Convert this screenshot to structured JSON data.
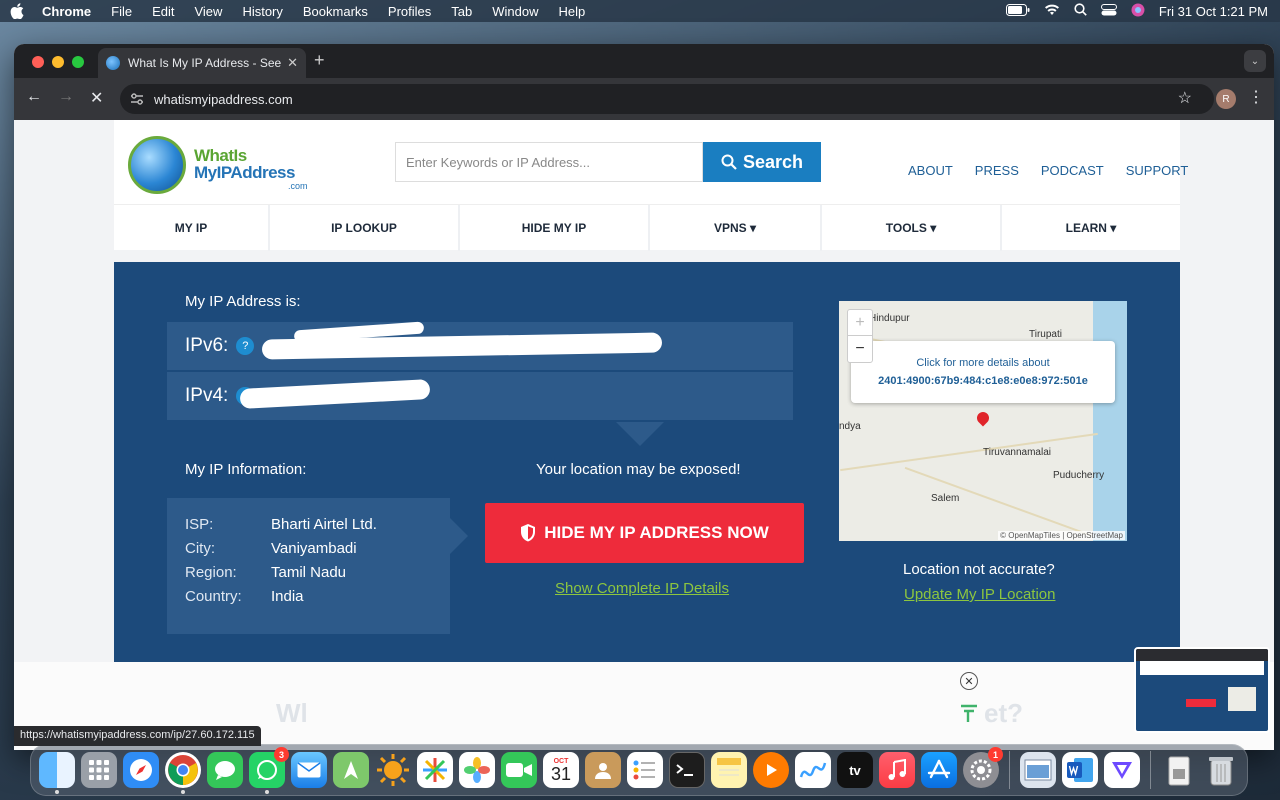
{
  "menubar": {
    "app": "Chrome",
    "items": [
      "File",
      "Edit",
      "View",
      "History",
      "Bookmarks",
      "Profiles",
      "Tab",
      "Window",
      "Help"
    ],
    "datetime": "Fri 31 Oct  1:21 PM"
  },
  "browser": {
    "tab_title": "What Is My IP Address - See",
    "url": "whatismyipaddress.com",
    "profile_initial": "R",
    "status_url": "https://whatismyipaddress.com/ip/27.60.172.115"
  },
  "site": {
    "logo_line1": "WhatIs",
    "logo_line2": "MyIPAddress",
    "logo_suffix": ".com",
    "search_placeholder": "Enter Keywords or IP Address...",
    "search_button": "Search",
    "top_links": [
      "ABOUT",
      "PRESS",
      "PODCAST",
      "SUPPORT"
    ],
    "nav": [
      "MY IP",
      "IP LOOKUP",
      "HIDE MY IP",
      "VPNS ▾",
      "TOOLS ▾",
      "LEARN ▾"
    ]
  },
  "hero": {
    "my_ip_label": "My IP Address is:",
    "ipv6_label": "IPv6:",
    "ipv4_label": "IPv4:",
    "help": "?",
    "info_label": "My IP Information:",
    "exposed": "Your location may be exposed!",
    "info": [
      {
        "k": "ISP:",
        "v": "Bharti Airtel Ltd."
      },
      {
        "k": "City:",
        "v": "Vaniyambadi"
      },
      {
        "k": "Region:",
        "v": "Tamil Nadu"
      },
      {
        "k": "Country:",
        "v": "India"
      }
    ],
    "hide_button": "HIDE MY IP ADDRESS NOW",
    "complete_link": "Show Complete IP Details",
    "not_accurate": "Location not accurate?",
    "update_link": "Update My IP Location"
  },
  "map": {
    "popup_line1": "Click for more details about",
    "popup_line2": "2401:4900:67b9:484:c1e8:e0e8:972:501e",
    "places": [
      "Hindupur",
      "Tirupati",
      "Tiruvannamalai",
      "Puducherry",
      "Salem",
      "ndya"
    ],
    "attribution": "© OpenMapTiles | OpenStreetMap",
    "zoom_in": "+",
    "zoom_out": "−"
  },
  "ad": {
    "left_text": "Wl",
    "right_text": "et?"
  },
  "dock": {
    "calendar_month": "OCT",
    "calendar_day": "31",
    "whatsapp_badge": "3",
    "settings_badge": "1",
    "tv_label": "tv"
  }
}
